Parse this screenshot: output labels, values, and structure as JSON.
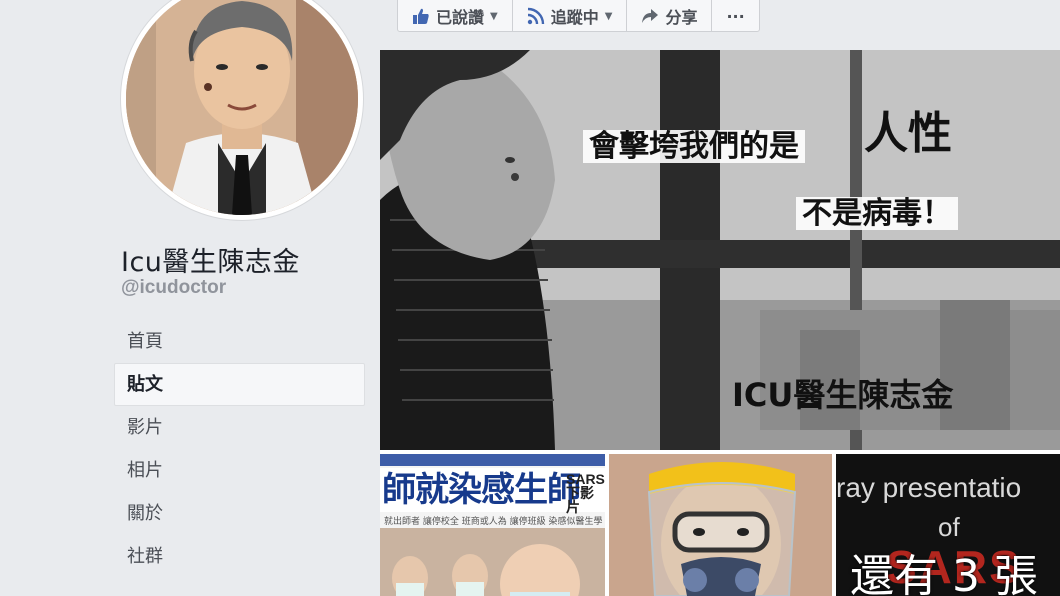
{
  "profile": {
    "name": "Icu醫生陳志金",
    "handle": "@icudoctor"
  },
  "nav": {
    "items": [
      {
        "label": "首頁",
        "active": false
      },
      {
        "label": "貼文",
        "active": true
      },
      {
        "label": "影片",
        "active": false
      },
      {
        "label": "相片",
        "active": false
      },
      {
        "label": "關於",
        "active": false
      },
      {
        "label": "社群",
        "active": false
      }
    ]
  },
  "toolbar": {
    "liked_label": "已說讚",
    "following_label": "追蹤中",
    "share_label": "分享",
    "more_label": "···",
    "icons": [
      "thumbs-up-icon",
      "rss-icon",
      "share-arrow-icon"
    ]
  },
  "main_photo": {
    "caption_line1": "會擊垮我們的是",
    "caption_highlight": "人性",
    "caption_line2": "不是病毒！",
    "signature": "ICU醫生陳志金"
  },
  "thumbnails": {
    "news_headline": "師就染感生師",
    "news_sars": "SARS",
    "news_sars_sub": "下影片",
    "news_sub": "就出師者 讓停校全 班商或人為 讓停班級 染感似醫生學一",
    "xray_line1": "ray presentatio",
    "xray_line2": "of",
    "xray_sars": "SARS",
    "xray_overlay": "還有 3 張"
  },
  "colors": {
    "bg": "#e9ebee",
    "text": "#1d2129",
    "muted": "#90949c",
    "fb_blue": "#4267b2"
  }
}
